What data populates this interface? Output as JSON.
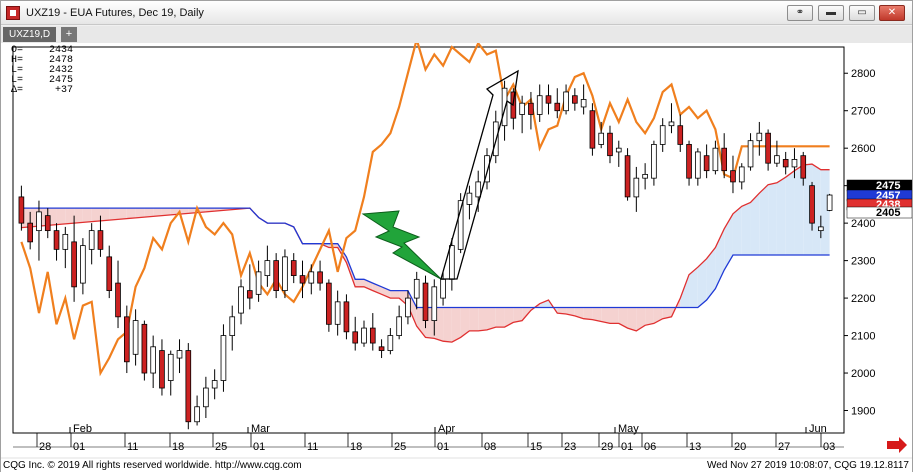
{
  "window": {
    "title": "UXZ19 - EUA Futures, Dec 19, Daily",
    "tab_label": "UXZ19,D",
    "tab_add": "+"
  },
  "ohlc": [
    {
      "key": "O=",
      "value": "2434"
    },
    {
      "key": "H=",
      "value": "2478"
    },
    {
      "key": "L=",
      "value": "2432"
    },
    {
      "key": "L=",
      "value": "2475"
    },
    {
      "key": "Δ=",
      "value": "+37"
    }
  ],
  "footer": {
    "copyright": "CQG Inc. © 2019 All rights reserved worldwide. http://www.cqg.com",
    "timestamp": "Wed Nov 27 2019 10:08:07, CQG 19.12.8117"
  },
  "colors": {
    "up": "#ffffff",
    "down": "#cc2222",
    "orange": "#f07f1e",
    "cloud_bull": "#d7e7f7",
    "cloud_bear": "#f5d2d0",
    "red_line": "#e03030",
    "blue_line": "#1f3ad6",
    "price_marker": "#000000",
    "green_bolt": "#21a43a"
  },
  "price_markers": [
    {
      "label": "2475",
      "bg": "#000000",
      "fg": "#ffffff"
    },
    {
      "label": "2457",
      "bg": "#1f3ad6",
      "fg": "#ffffff"
    },
    {
      "label": "2438",
      "bg": "#e03030",
      "fg": "#ffffff"
    },
    {
      "label": "2405",
      "bg": "#ffffff",
      "fg": "#000000"
    }
  ],
  "chart_data": {
    "type": "candlestick",
    "y_ticks": [
      1900,
      2000,
      2100,
      2200,
      2300,
      2400,
      2500,
      2600,
      2700,
      2800
    ],
    "ylim": [
      1840,
      2870
    ],
    "month_labels": [
      "Feb",
      "Mar",
      "Apr",
      "May",
      "Jun"
    ],
    "day_labels": [
      "28",
      "01",
      "11",
      "18",
      "25",
      "01",
      "11",
      "18",
      "25",
      "01",
      "08",
      "15",
      "23",
      "29",
      "01",
      "06",
      "13",
      "20",
      "27",
      "03"
    ],
    "candles": [
      {
        "o": 2470,
        "h": 2500,
        "l": 2380,
        "c": 2400
      },
      {
        "o": 2400,
        "h": 2430,
        "l": 2330,
        "c": 2350
      },
      {
        "o": 2380,
        "h": 2460,
        "l": 2300,
        "c": 2430
      },
      {
        "o": 2420,
        "h": 2440,
        "l": 2360,
        "c": 2380
      },
      {
        "o": 2380,
        "h": 2400,
        "l": 2300,
        "c": 2330
      },
      {
        "o": 2330,
        "h": 2390,
        "l": 2280,
        "c": 2370
      },
      {
        "o": 2350,
        "h": 2420,
        "l": 2190,
        "c": 2230
      },
      {
        "o": 2240,
        "h": 2360,
        "l": 2210,
        "c": 2340
      },
      {
        "o": 2330,
        "h": 2400,
        "l": 2290,
        "c": 2380
      },
      {
        "o": 2380,
        "h": 2420,
        "l": 2310,
        "c": 2330
      },
      {
        "o": 2310,
        "h": 2340,
        "l": 2200,
        "c": 2220
      },
      {
        "o": 2240,
        "h": 2300,
        "l": 2120,
        "c": 2150
      },
      {
        "o": 2150,
        "h": 2180,
        "l": 2000,
        "c": 2030
      },
      {
        "o": 2050,
        "h": 2170,
        "l": 2020,
        "c": 2140
      },
      {
        "o": 2130,
        "h": 2140,
        "l": 1980,
        "c": 2000
      },
      {
        "o": 2000,
        "h": 2100,
        "l": 1960,
        "c": 2070
      },
      {
        "o": 2060,
        "h": 2090,
        "l": 1940,
        "c": 1960
      },
      {
        "o": 1980,
        "h": 2060,
        "l": 1940,
        "c": 2050
      },
      {
        "o": 2040,
        "h": 2090,
        "l": 2000,
        "c": 2060
      },
      {
        "o": 2060,
        "h": 2080,
        "l": 1850,
        "c": 1870
      },
      {
        "o": 1870,
        "h": 1940,
        "l": 1860,
        "c": 1910
      },
      {
        "o": 1910,
        "h": 1990,
        "l": 1880,
        "c": 1960
      },
      {
        "o": 1960,
        "h": 2010,
        "l": 1930,
        "c": 1980
      },
      {
        "o": 1980,
        "h": 2130,
        "l": 1950,
        "c": 2100
      },
      {
        "o": 2100,
        "h": 2180,
        "l": 2060,
        "c": 2150
      },
      {
        "o": 2160,
        "h": 2250,
        "l": 2130,
        "c": 2230
      },
      {
        "o": 2220,
        "h": 2290,
        "l": 2170,
        "c": 2200
      },
      {
        "o": 2210,
        "h": 2300,
        "l": 2190,
        "c": 2270
      },
      {
        "o": 2260,
        "h": 2340,
        "l": 2230,
        "c": 2300
      },
      {
        "o": 2300,
        "h": 2320,
        "l": 2200,
        "c": 2220
      },
      {
        "o": 2220,
        "h": 2330,
        "l": 2200,
        "c": 2310
      },
      {
        "o": 2300,
        "h": 2320,
        "l": 2240,
        "c": 2260
      },
      {
        "o": 2260,
        "h": 2300,
        "l": 2200,
        "c": 2240
      },
      {
        "o": 2240,
        "h": 2290,
        "l": 2210,
        "c": 2270
      },
      {
        "o": 2270,
        "h": 2300,
        "l": 2220,
        "c": 2240
      },
      {
        "o": 2240,
        "h": 2250,
        "l": 2110,
        "c": 2130
      },
      {
        "o": 2130,
        "h": 2220,
        "l": 2100,
        "c": 2190
      },
      {
        "o": 2190,
        "h": 2210,
        "l": 2090,
        "c": 2110
      },
      {
        "o": 2110,
        "h": 2150,
        "l": 2060,
        "c": 2080
      },
      {
        "o": 2080,
        "h": 2140,
        "l": 2070,
        "c": 2120
      },
      {
        "o": 2120,
        "h": 2160,
        "l": 2060,
        "c": 2080
      },
      {
        "o": 2070,
        "h": 2090,
        "l": 2040,
        "c": 2060
      },
      {
        "o": 2060,
        "h": 2120,
        "l": 2050,
        "c": 2100
      },
      {
        "o": 2100,
        "h": 2180,
        "l": 2090,
        "c": 2150
      },
      {
        "o": 2150,
        "h": 2220,
        "l": 2130,
        "c": 2200
      },
      {
        "o": 2200,
        "h": 2270,
        "l": 2170,
        "c": 2250
      },
      {
        "o": 2240,
        "h": 2260,
        "l": 2120,
        "c": 2140
      },
      {
        "o": 2140,
        "h": 2250,
        "l": 2100,
        "c": 2230
      },
      {
        "o": 2200,
        "h": 2270,
        "l": 2180,
        "c": 2250
      },
      {
        "o": 2250,
        "h": 2360,
        "l": 2220,
        "c": 2340
      },
      {
        "o": 2330,
        "h": 2480,
        "l": 2320,
        "c": 2460
      },
      {
        "o": 2450,
        "h": 2500,
        "l": 2410,
        "c": 2480
      },
      {
        "o": 2470,
        "h": 2540,
        "l": 2430,
        "c": 2510
      },
      {
        "o": 2510,
        "h": 2600,
        "l": 2490,
        "c": 2580
      },
      {
        "o": 2580,
        "h": 2700,
        "l": 2560,
        "c": 2670
      },
      {
        "o": 2660,
        "h": 2780,
        "l": 2620,
        "c": 2760
      },
      {
        "o": 2750,
        "h": 2760,
        "l": 2650,
        "c": 2680
      },
      {
        "o": 2690,
        "h": 2740,
        "l": 2640,
        "c": 2720
      },
      {
        "o": 2720,
        "h": 2750,
        "l": 2650,
        "c": 2690
      },
      {
        "o": 2690,
        "h": 2770,
        "l": 2670,
        "c": 2740
      },
      {
        "o": 2740,
        "h": 2770,
        "l": 2690,
        "c": 2720
      },
      {
        "o": 2720,
        "h": 2760,
        "l": 2680,
        "c": 2700
      },
      {
        "o": 2700,
        "h": 2770,
        "l": 2690,
        "c": 2750
      },
      {
        "o": 2740,
        "h": 2760,
        "l": 2700,
        "c": 2720
      },
      {
        "o": 2710,
        "h": 2770,
        "l": 2690,
        "c": 2730
      },
      {
        "o": 2700,
        "h": 2720,
        "l": 2580,
        "c": 2600
      },
      {
        "o": 2610,
        "h": 2670,
        "l": 2600,
        "c": 2640
      },
      {
        "o": 2640,
        "h": 2660,
        "l": 2560,
        "c": 2580
      },
      {
        "o": 2590,
        "h": 2620,
        "l": 2550,
        "c": 2600
      },
      {
        "o": 2580,
        "h": 2600,
        "l": 2460,
        "c": 2470
      },
      {
        "o": 2470,
        "h": 2550,
        "l": 2430,
        "c": 2520
      },
      {
        "o": 2520,
        "h": 2560,
        "l": 2490,
        "c": 2530
      },
      {
        "o": 2520,
        "h": 2620,
        "l": 2500,
        "c": 2610
      },
      {
        "o": 2610,
        "h": 2680,
        "l": 2590,
        "c": 2660
      },
      {
        "o": 2660,
        "h": 2720,
        "l": 2640,
        "c": 2670
      },
      {
        "o": 2660,
        "h": 2690,
        "l": 2590,
        "c": 2610
      },
      {
        "o": 2610,
        "h": 2620,
        "l": 2500,
        "c": 2520
      },
      {
        "o": 2520,
        "h": 2600,
        "l": 2500,
        "c": 2590
      },
      {
        "o": 2580,
        "h": 2610,
        "l": 2520,
        "c": 2540
      },
      {
        "o": 2540,
        "h": 2620,
        "l": 2530,
        "c": 2600
      },
      {
        "o": 2600,
        "h": 2640,
        "l": 2520,
        "c": 2540
      },
      {
        "o": 2540,
        "h": 2580,
        "l": 2480,
        "c": 2510
      },
      {
        "o": 2510,
        "h": 2560,
        "l": 2490,
        "c": 2550
      },
      {
        "o": 2550,
        "h": 2640,
        "l": 2540,
        "c": 2620
      },
      {
        "o": 2620,
        "h": 2670,
        "l": 2580,
        "c": 2640
      },
      {
        "o": 2640,
        "h": 2650,
        "l": 2540,
        "c": 2560
      },
      {
        "o": 2560,
        "h": 2620,
        "l": 2550,
        "c": 2580
      },
      {
        "o": 2570,
        "h": 2590,
        "l": 2530,
        "c": 2550
      },
      {
        "o": 2550,
        "h": 2600,
        "l": 2520,
        "c": 2570
      },
      {
        "o": 2580,
        "h": 2590,
        "l": 2500,
        "c": 2520
      },
      {
        "o": 2500,
        "h": 2510,
        "l": 2380,
        "c": 2400
      },
      {
        "o": 2380,
        "h": 2420,
        "l": 2360,
        "c": 2390
      },
      {
        "o": 2434,
        "h": 2478,
        "l": 2432,
        "c": 2475
      }
    ]
  }
}
